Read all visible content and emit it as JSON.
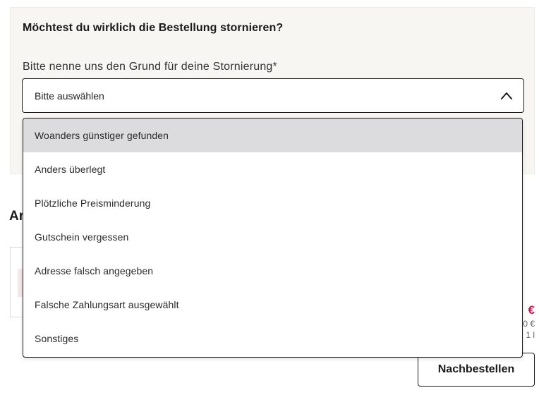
{
  "cancel_panel": {
    "title": "Möchtest du wirklich die Bestellung stornieren?",
    "reason_label": "Bitte nenne uns den Grund für deine Stornierung*",
    "select_value": "Bitte auswählen"
  },
  "dropdown": {
    "options": [
      "Woanders günstiger gefunden",
      "Anders überlegt",
      "Plötzliche Preisminderung",
      "Gutschein vergessen",
      "Adresse falsch angegeben",
      "Falsche Zahlungsart ausgewählt",
      "Sonstiges"
    ],
    "highlighted_index": 0
  },
  "background": {
    "section_heading": "Ar",
    "price_main": "€",
    "price_old": "0 €",
    "price_unit": "1 l",
    "reorder_label": "Nachbestellen"
  },
  "colors": {
    "accent": "#d4124b",
    "panel_bg": "#f7f6f3",
    "highlight_bg": "#dcdcde"
  }
}
